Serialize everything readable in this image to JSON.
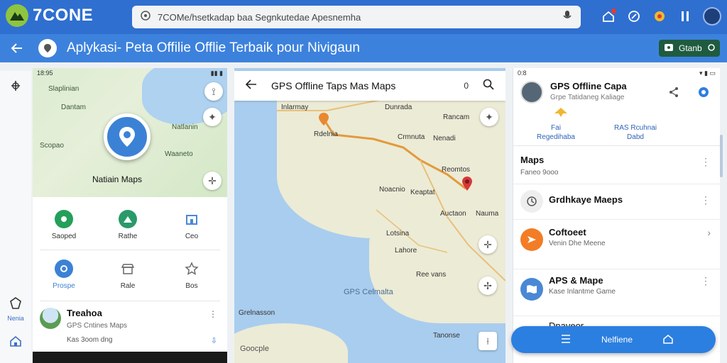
{
  "brand": {
    "name": "7CONE",
    "logo_color": "#8fc440"
  },
  "address_bar": {
    "url": "7COMe/hsetkadap baa Segnkutedae Apesnemha"
  },
  "header_icons": [
    "home-icon",
    "link-icon",
    "bell-icon",
    "more-vert-icon",
    "avatar"
  ],
  "titlebar": {
    "title": "Aplykasi- Peta Offilie Offlie Terbaik pour Nivigaun",
    "open_label": "Gtanb"
  },
  "rail": {
    "items": [
      {
        "icon": "compass-icon",
        "label": ""
      },
      {
        "icon": "shield-icon",
        "label": "Nenia"
      },
      {
        "icon": "home-icon",
        "label": ""
      }
    ]
  },
  "phone1": {
    "status_time": "18:95",
    "map_labels": [
      "Slaplinian",
      "Dantam",
      "Scopao",
      "Natlanin",
      "Waaneto"
    ],
    "map_title": "Natiain Maps",
    "grid": [
      {
        "label": "Saoped",
        "icon": "location-icon",
        "color": "#23a05a"
      },
      {
        "label": "Rathe",
        "icon": "hiking-icon",
        "color": "#2a9a6a"
      },
      {
        "label": "Ceo",
        "icon": "building-icon",
        "color": "#4a88d6"
      },
      {
        "label": "Prospe",
        "icon": "pin-icon",
        "color": "#3b82d6"
      },
      {
        "label": "Rale",
        "icon": "store-icon",
        "color": "#777777"
      },
      {
        "label": "Bos",
        "icon": "star-icon",
        "color": "#777777"
      }
    ],
    "app": {
      "name": "Treahoa",
      "subtitle": "GPS Cntines Maps",
      "meta": "Kas 3oom dng"
    }
  },
  "phone2": {
    "search_query": "GPS Offline Taps Mas Maps",
    "search_right": "0",
    "labels": [
      "Inlarmay",
      "Dunrada",
      "Rancam",
      "Rdelnia",
      "Nenadi",
      "Crmnuta",
      "Reomtos",
      "Keaptat",
      "Noacnio",
      "Auctaon",
      "Nauma",
      "Lotsina",
      "Lahore",
      "Ree vans",
      "Tanonse",
      "Grelnasson"
    ],
    "sea_label": "GPS Celmalta",
    "attribution": "Goocple"
  },
  "phone3": {
    "status_time": "0:8",
    "app_title": "GPS Offline Capa",
    "app_sub": "Grpe Tatidaneg Kaliage",
    "stats": [
      {
        "line1": "Fai",
        "line2": "Regedihaba"
      },
      {
        "line1": "RAS Rcuhnai",
        "line2": "Dabd"
      }
    ],
    "list": [
      {
        "title": "Maps",
        "sub": "Faneo 9ooo",
        "icon": "",
        "color": "#ffffff"
      },
      {
        "title": "Grdhkaye Maeps",
        "sub": "",
        "icon": "clock-icon",
        "color": "#eeeeee"
      },
      {
        "title": "Coftoeet",
        "sub": "Venin Dhe Meene",
        "icon": "send-icon",
        "color": "#f27d26"
      },
      {
        "title": "APS & Mape",
        "sub": "Kase Inlantme Game",
        "icon": "map-icon",
        "color": "#4a88d6"
      },
      {
        "title": "Dnaveor",
        "sub": "",
        "icon": "",
        "color": "#ffffff"
      }
    ],
    "nav_pill": {
      "label": "Nelfiene"
    }
  }
}
